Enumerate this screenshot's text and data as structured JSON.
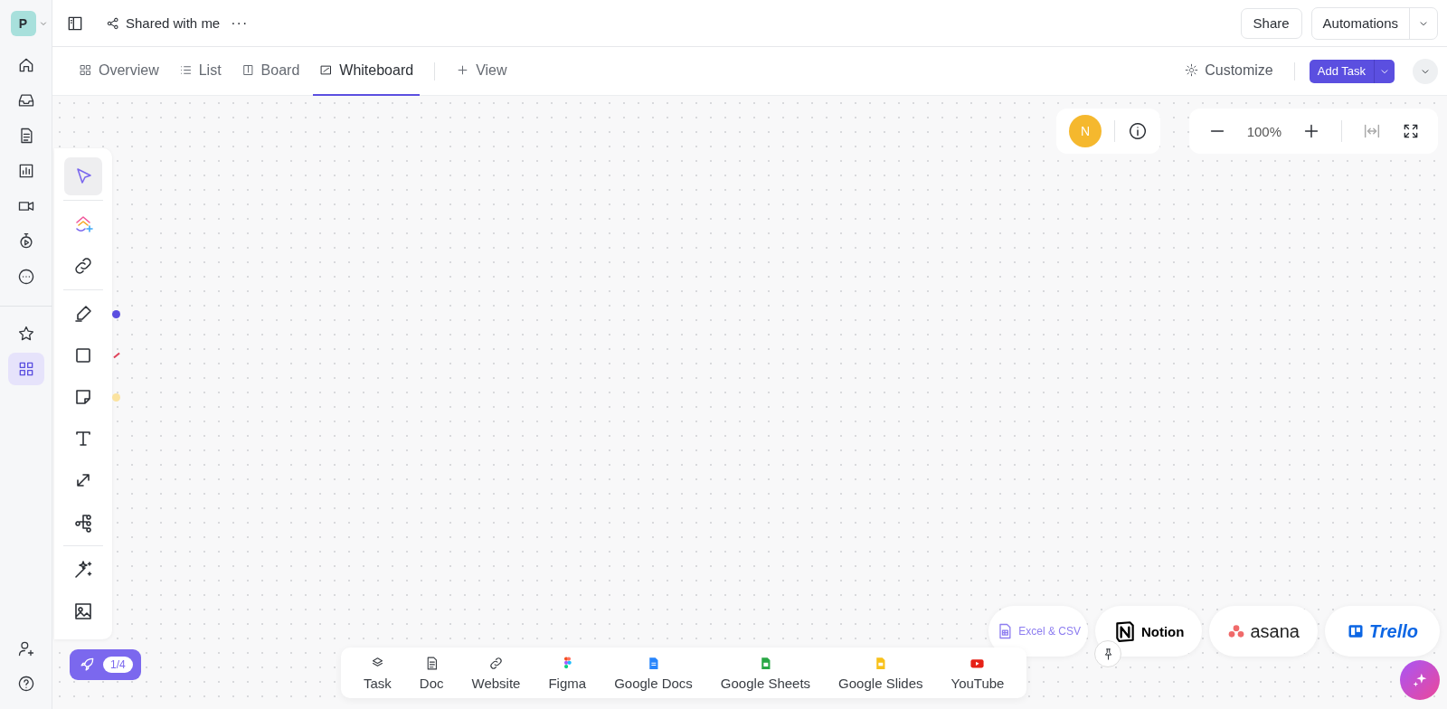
{
  "workspace": {
    "initial": "P"
  },
  "rail_top": [
    {
      "kind": "home",
      "selected": false
    },
    {
      "kind": "inbox",
      "selected": false
    },
    {
      "kind": "doc",
      "selected": false
    },
    {
      "kind": "chart",
      "selected": false
    },
    {
      "kind": "video",
      "selected": false
    },
    {
      "kind": "timer",
      "selected": false
    },
    {
      "kind": "more",
      "selected": false
    }
  ],
  "rail_mid": [
    {
      "kind": "star",
      "selected": false
    },
    {
      "kind": "grid",
      "selected": true
    }
  ],
  "rail_bottom": [
    {
      "kind": "useradd",
      "selected": false
    },
    {
      "kind": "help",
      "selected": false
    }
  ],
  "breadcrumb": {
    "title": "Shared with me",
    "more": "···"
  },
  "header_buttons": {
    "share": "Share",
    "automations": "Automations"
  },
  "tabs": [
    {
      "kind": "overview",
      "label": "Overview",
      "selected": false
    },
    {
      "kind": "list",
      "label": "List",
      "selected": false
    },
    {
      "kind": "board",
      "label": "Board",
      "selected": false
    },
    {
      "kind": "whiteboard",
      "label": "Whiteboard",
      "selected": true
    }
  ],
  "add_view": "View",
  "customize": "Customize",
  "add_task": "Add Task",
  "presence": {
    "avatar": "N"
  },
  "zoom": {
    "value": "100%"
  },
  "tools": [
    {
      "kind": "cursor",
      "selected": true
    },
    {
      "kind": "divider"
    },
    {
      "kind": "ai-create",
      "selected": false
    },
    {
      "kind": "link",
      "selected": false
    },
    {
      "kind": "divider"
    },
    {
      "kind": "pen",
      "selected": false,
      "color": "#5b4fe0"
    },
    {
      "kind": "rect",
      "selected": false,
      "color": "#e0435a"
    },
    {
      "kind": "sticky",
      "selected": false,
      "color": "#fbe3a0"
    },
    {
      "kind": "text",
      "selected": false
    },
    {
      "kind": "connector",
      "selected": false
    },
    {
      "kind": "mindmap",
      "selected": false
    },
    {
      "kind": "divider"
    },
    {
      "kind": "magic",
      "selected": false
    },
    {
      "kind": "image",
      "selected": false
    }
  ],
  "onboarding": {
    "progress": "1/4"
  },
  "sources": [
    {
      "kind": "task",
      "label": "Task"
    },
    {
      "kind": "doc",
      "label": "Doc"
    },
    {
      "kind": "website",
      "label": "Website"
    },
    {
      "kind": "figma",
      "label": "Figma"
    },
    {
      "kind": "gdocs",
      "label": "Google Docs"
    },
    {
      "kind": "gsheets",
      "label": "Google Sheets"
    },
    {
      "kind": "gslides",
      "label": "Google Slides"
    },
    {
      "kind": "youtube",
      "label": "YouTube"
    }
  ],
  "imports": [
    {
      "kind": "excel",
      "label": "Excel & CSV"
    },
    {
      "kind": "notion",
      "label": "Notion"
    },
    {
      "kind": "asana",
      "label": "asana"
    },
    {
      "kind": "trello",
      "label": "Trello"
    }
  ]
}
